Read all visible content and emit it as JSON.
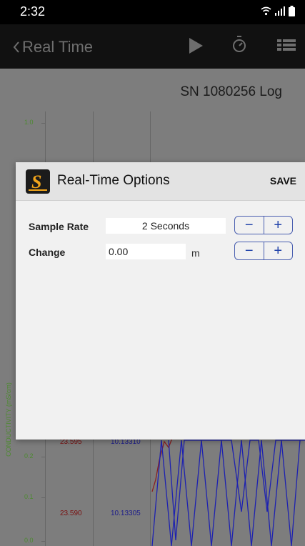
{
  "status_bar": {
    "time": "2:32"
  },
  "toolbar": {
    "back_label": "Real Time"
  },
  "graph": {
    "log_title": "SN 1080256 Log",
    "y_ticks": [
      "1.0",
      "0.2",
      "0.1",
      "0.0"
    ],
    "axis_label": "CONDUCTIVITY (mS/cm)",
    "red_values": [
      "23.595",
      "23.590"
    ],
    "blue_values": [
      "10.13310",
      "10.13305"
    ]
  },
  "dialog": {
    "title": "Real-Time Options",
    "save_label": "SAVE",
    "sample_rate_label": "Sample Rate",
    "sample_rate_value": "2 Seconds",
    "change_label": "Change",
    "change_value": "0.00",
    "change_unit": "m",
    "minus_label": "−",
    "plus_label": "+"
  },
  "colors": {
    "accent": "#2244aa",
    "series_red": "#b22020",
    "series_blue": "#1e22b0",
    "logo": "#f2a51b"
  }
}
